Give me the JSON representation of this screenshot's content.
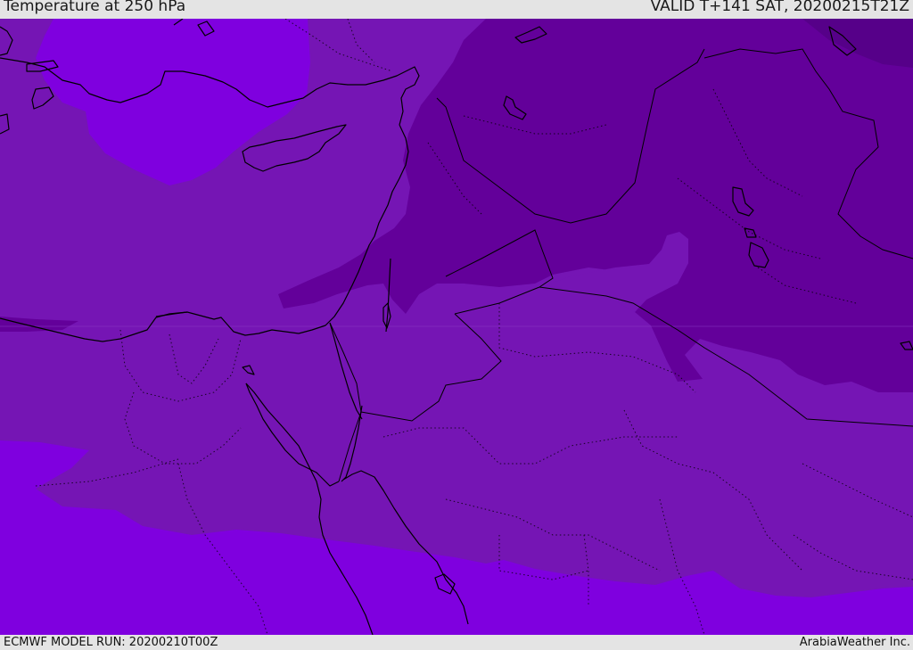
{
  "header": {
    "title": "Temperature at 250 hPa",
    "valid_time": "VALID T+141 SAT, 20200215T21Z"
  },
  "footer": {
    "model_run": "ECMWF MODEL RUN: 20200210T00Z",
    "credit": "ArabiaWeather Inc."
  },
  "map": {
    "field": "temperature",
    "level": "250 hPa",
    "colors": {
      "warm_band": "#7f00df",
      "mid_band": "#7515b4",
      "cold_band": "#63009a",
      "coastline": "#000000",
      "border": "#000000",
      "province_border": "#000000"
    }
  }
}
